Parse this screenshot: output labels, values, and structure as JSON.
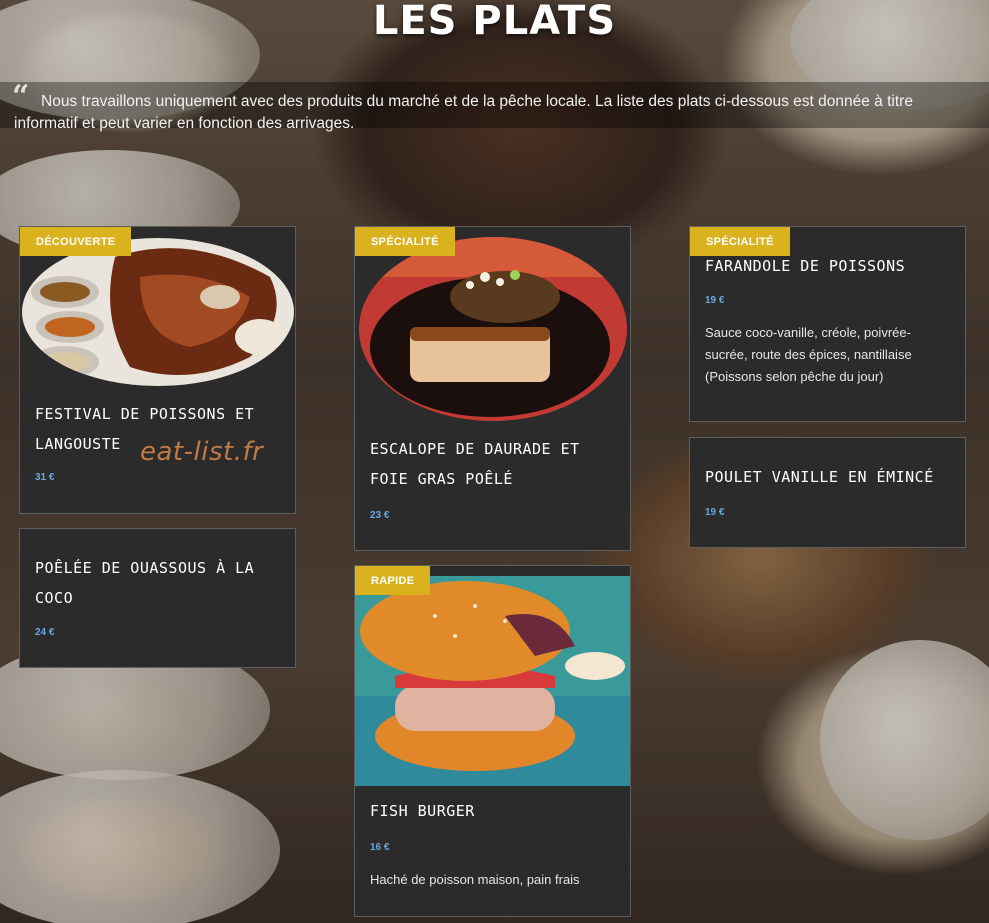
{
  "page": {
    "title": "LES PLATS",
    "intro": "Nous travaillons uniquement avec des produits du marché et de la pêche locale. La liste des plats ci-dessous est donnée à titre informatif et peut varier en fonction des arrivages.",
    "watermark": "eat-list.fr"
  },
  "dishes": [
    {
      "badge": "DÉCOUVERTE",
      "name": "Festival de poissons et langouste",
      "price": "31 €",
      "description": "",
      "has_photo": true
    },
    {
      "badge": "",
      "name": "Poêlée de ouassous à la coco",
      "price": "24 €",
      "description": "",
      "has_photo": false
    },
    {
      "badge": "SPÉCIALITÉ",
      "name": "Escalope de daurade et foie gras poêlé",
      "price": "23 €",
      "description": "",
      "has_photo": true
    },
    {
      "badge": "RAPIDE",
      "name": "Fish burger",
      "price": "16 €",
      "description": "Haché de poisson maison, pain frais",
      "has_photo": true
    },
    {
      "badge": "SPÉCIALITÉ",
      "name": "Farandole de poissons",
      "price": "19 €",
      "description": "Sauce coco-vanille, créole, poivrée-sucrée, route des épices, nantillaise (Poissons selon pêche du jour)",
      "has_photo": false
    },
    {
      "badge": "",
      "name": "Poulet vanille en émincé",
      "price": "19 €",
      "description": "",
      "has_photo": false
    }
  ],
  "colors": {
    "badge": "#d9b21e",
    "card": "#2b2b2b",
    "price": "#6aa6e0",
    "title": "#ffffff"
  },
  "icons": {
    "quote": "quote-icon"
  }
}
